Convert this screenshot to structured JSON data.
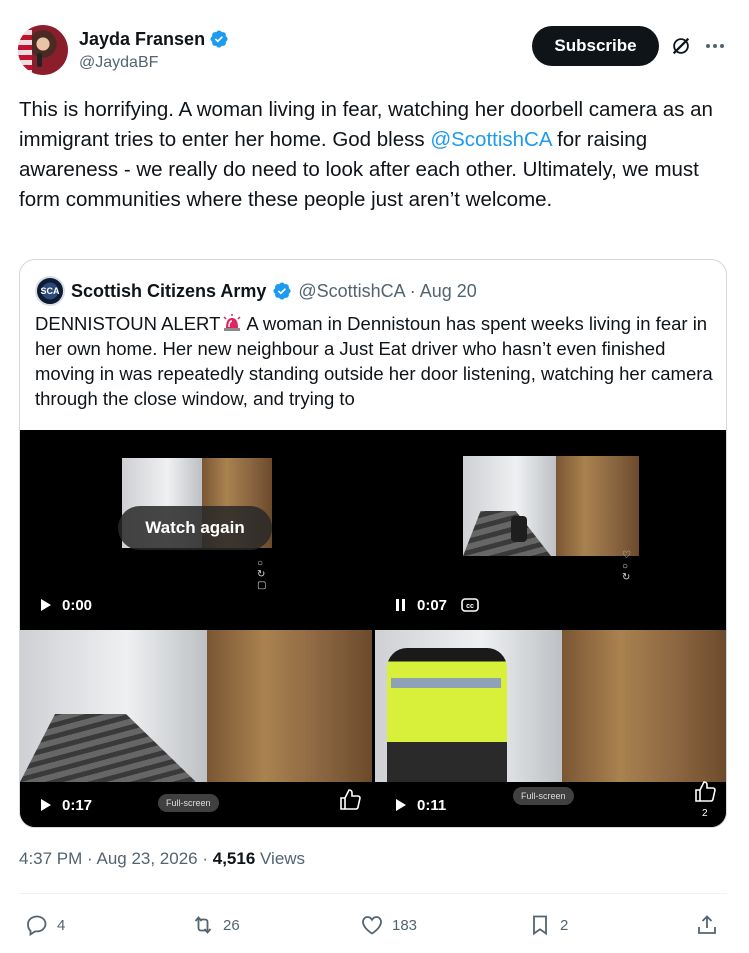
{
  "author": {
    "display_name": "Jayda Fransen",
    "handle": "@JaydaBF",
    "verified": true
  },
  "header": {
    "subscribe_label": "Subscribe"
  },
  "tweet": {
    "text_before_mention": "This is horrifying. A woman living in fear, watching her doorbell camera as an immigrant tries to enter her home. God bless ",
    "mention": "@ScottishCA",
    "text_after_mention": " for raising awareness - we really do need to look after each other. Ultimately, we must form communities where these people just aren’t welcome."
  },
  "quote": {
    "avatar_text": "SCA",
    "display_name": "Scottish Citizens Army",
    "handle_and_date": "@ScottishCA · Aug 20",
    "text_before_emoji": "DENNISTOUN ALERT",
    "text_after_emoji": "A woman in Dennistoun has spent weeks living in fear in her own home.  Her new neighbour a Just Eat driver who hasn’t even finished moving in was repeatedly standing outside her door listening, watching her camera through the close window, and trying to",
    "media": [
      {
        "time": "0:00",
        "state": "ended",
        "overlay": "Watch again"
      },
      {
        "time": "0:07",
        "state": "playing",
        "captions": true
      },
      {
        "time": "0:17",
        "state": "paused",
        "chip": "Full-screen"
      },
      {
        "time": "0:11",
        "state": "paused",
        "chip": "Full-screen",
        "like_count": "2"
      }
    ]
  },
  "meta": {
    "timestamp": "4:37 PM · Aug 23, 2026 · ",
    "views_count": "4,516",
    "views_label": " Views"
  },
  "actions": {
    "replies": "4",
    "reposts": "26",
    "likes": "183",
    "bookmarks": "2"
  },
  "colors": {
    "link": "#1d9bf0",
    "verified": "#1d9bf0",
    "text": "#0f1419",
    "secondary": "#536471"
  }
}
